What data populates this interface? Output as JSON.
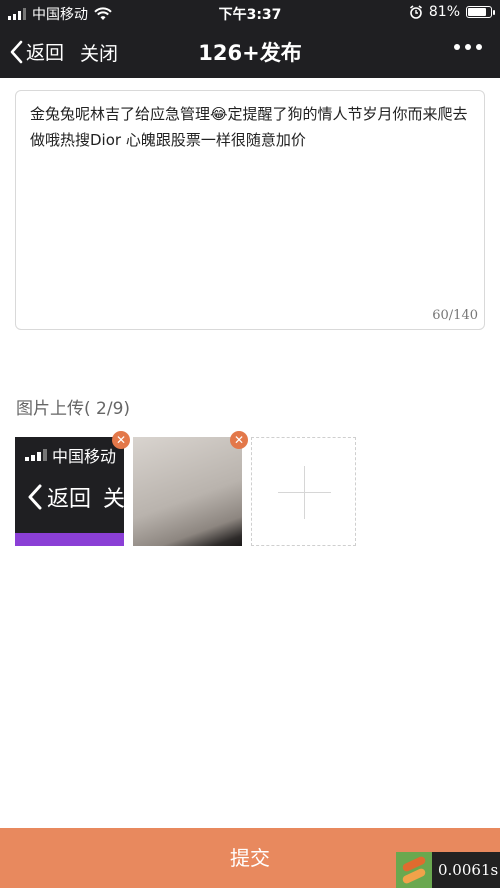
{
  "status_bar": {
    "carrier": "中国移动",
    "time": "下午3:37",
    "battery": "81%",
    "battery_level": 0.81
  },
  "nav": {
    "back_label": "返回",
    "close_label": "关闭",
    "title": "126+发布"
  },
  "editor": {
    "text": "金兔兔呢林吉了给应急管理😂定提醒了狗的情人节岁月你而来爬去做哦热搜Dior 心魄跟股票一样很随意加价",
    "counter": "60/140"
  },
  "upload": {
    "label": "图片上传( 2/9)",
    "thumbnails": [
      {
        "carrier": "中国移动",
        "back_label": "返回",
        "close_fragment": "关"
      },
      {}
    ]
  },
  "submit_label": "提交",
  "timer_badge": "0.0061s",
  "colors": {
    "navbar_bg": "#1f1f22",
    "accent": "#e8895e",
    "remove_badge": "#e3784a"
  }
}
